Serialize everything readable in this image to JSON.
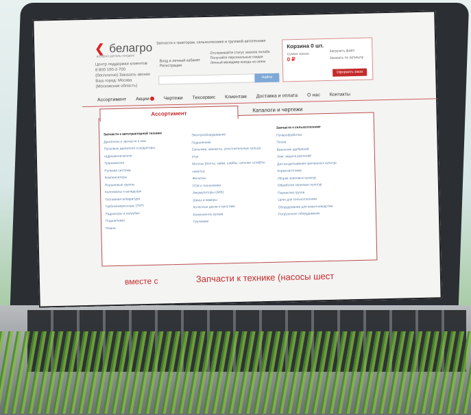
{
  "header": {
    "logo_text": "белагро",
    "logo_sub": "аграрно-деталь-холдинг",
    "tagline": "Запчасти к тракторам, сельхозтехнике и грузовой автотехнике",
    "help_lines": [
      "Центр поддержки клиентов",
      "8 800 100-2-700",
      "(бесплатно) Заказать звонок",
      "Ваш город: Москва",
      "(Московская область)"
    ],
    "login": [
      "Вход в личный кабинет",
      "Регистрация"
    ],
    "bullets": [
      "Отслеживайте статус заказов онлайн",
      "Получайте персональные скидки",
      "Личный менеджер всегда на связи"
    ],
    "search_button": "Найти"
  },
  "cart": {
    "title": "Корзина",
    "count": "0 шт.",
    "line": "Сумма заказа",
    "sum": "0 ₽",
    "link1": "Загрузить файл",
    "link2": "Заказать по артикулу",
    "order_button": "Оформить заказ"
  },
  "nav": {
    "items": [
      "Ассортимент",
      "Акции",
      "Чертежи",
      "Техсервис",
      "Клиентам",
      "Доставка и оплата",
      "О нас",
      "Контакты"
    ]
  },
  "dropdown": {
    "tab_active": "Ассортимент",
    "tab2": "Каталоги и чертежи",
    "col1_title": "Запчасти к автотракторной технике",
    "col1": [
      "Двигатели и запчасти к ним",
      "Пусковые двигатели и редукторы, гидроувеличители",
      "Трансмиссия",
      "Рулевая система",
      "Компенсаторы",
      "Поршневые группы",
      "Коленвалы и вкладыши",
      "Топливная аппаратура",
      "Турбокомпрессоры (ТКР)",
      "Радиаторы и патрубки",
      "Подшипники",
      "Ремни"
    ],
    "col2": [
      "Электрооборудование",
      "Подшипники",
      "Сальники, манжеты, уплотнительные кольца, РТИ",
      "Метизы (болты, гайки, шайбы, шпонки, штифты, хомуты)",
      "Фильтры",
      "ГСМ и технохимия",
      "Аккумуляторы (АКБ)",
      "Шины и камеры",
      "Колесные диски и простаки",
      "Компоненты кузова",
      "Грузовики"
    ],
    "col3_title": "Запчасти к сельхозтехнике",
    "col3": [
      "Почвообработка",
      "Посев",
      "Внесение удобрений",
      "Хим. защита растений",
      "Для возделывания пропашных культур",
      "Кормозаготовка",
      "Уборка зерновых культур",
      "Обработка зерновых культур",
      "Перевозка грузов",
      "Цепи для сельхозтехники",
      "Оборудование для животноводства",
      "Погрузочное оборудование"
    ]
  },
  "promo": {
    "left": "вместе с",
    "right": "Запчасти к технике (насосы шест"
  }
}
